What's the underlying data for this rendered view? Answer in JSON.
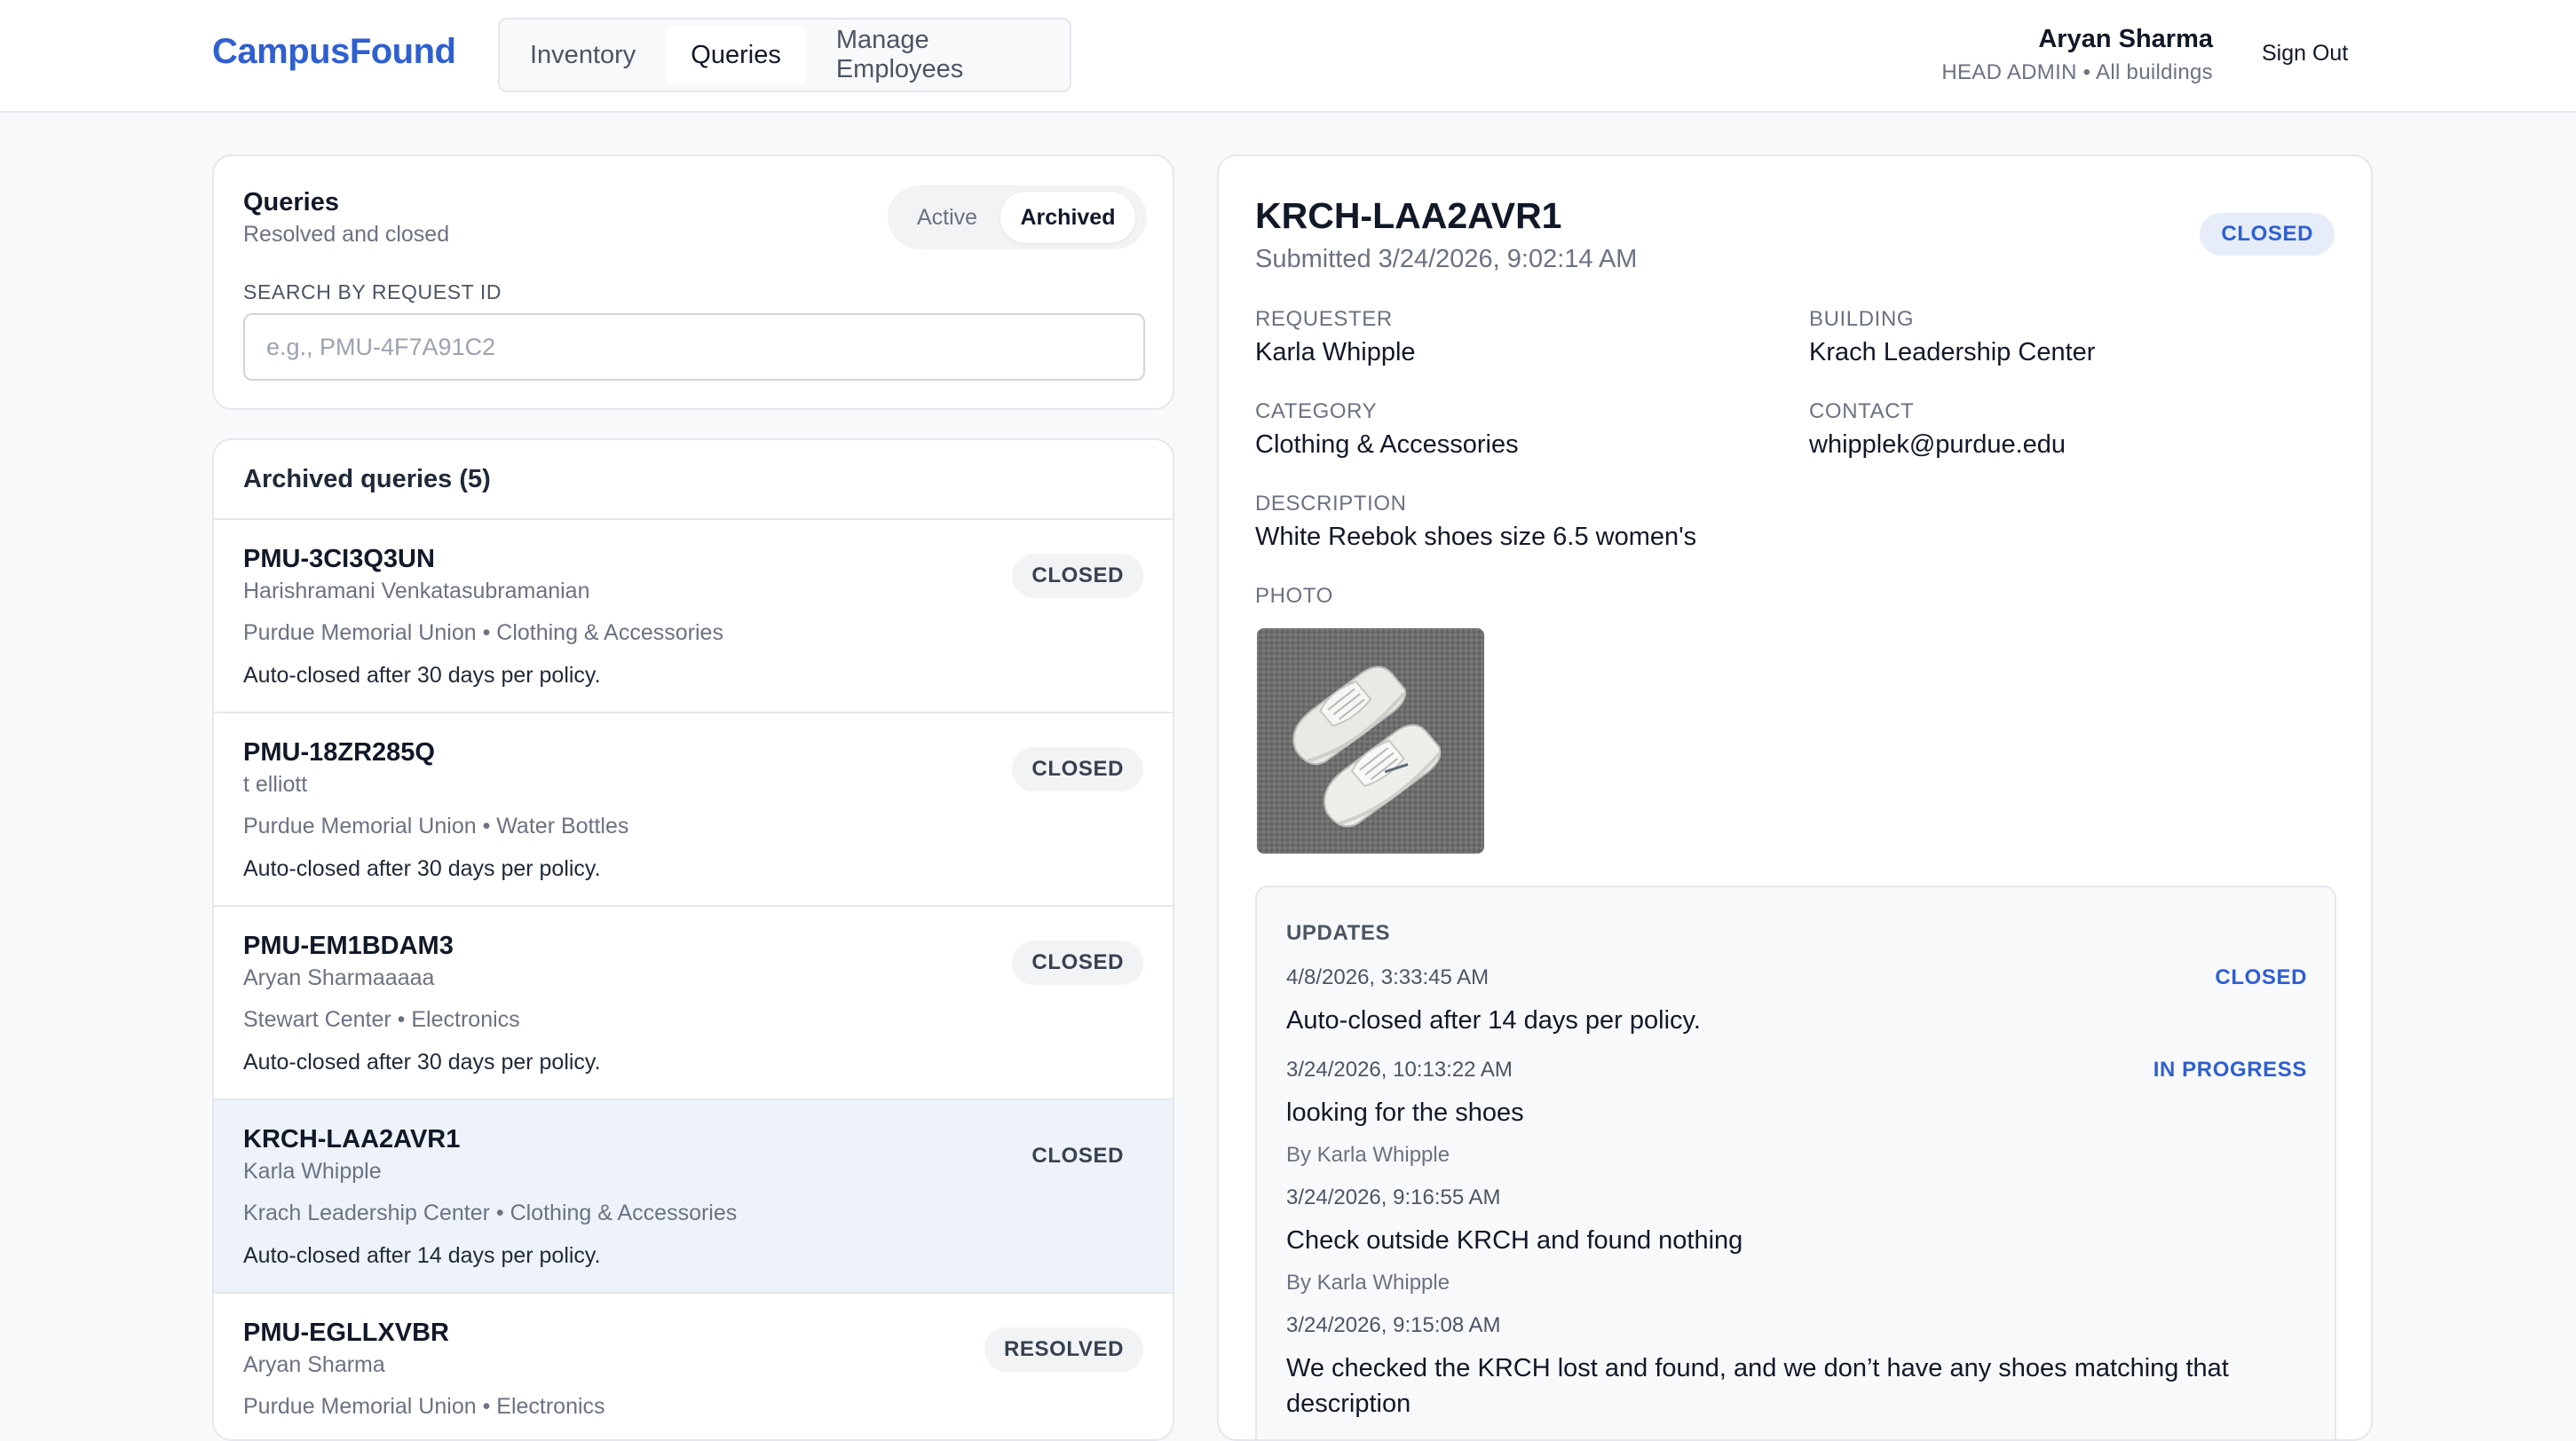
{
  "header": {
    "brand": "CampusFound",
    "tabs": [
      {
        "label": "Inventory",
        "active": false
      },
      {
        "label": "Queries",
        "active": true
      },
      {
        "label": "Manage Employees",
        "active": false
      }
    ],
    "user_name": "Aryan Sharma",
    "user_role": "HEAD ADMIN • All buildings",
    "sign_out": "Sign Out"
  },
  "queries_panel": {
    "title": "Queries",
    "subtitle": "Resolved and closed",
    "toggle": {
      "active_label": "Active",
      "archived_label": "Archived",
      "selected": "Archived"
    },
    "search_label": "SEARCH BY REQUEST ID",
    "search_placeholder": "e.g., PMU-4F7A91C2",
    "search_value": ""
  },
  "archived_list": {
    "header": "Archived queries (5)",
    "items": [
      {
        "id": "PMU-3CI3Q3UN",
        "name": "Harishramani Venkatasubramanian",
        "meta": "Purdue Memorial Union • Clothing & Accessories",
        "note": "Auto-closed after 30 days per policy.",
        "status": "CLOSED",
        "selected": false
      },
      {
        "id": "PMU-18ZR285Q",
        "name": "t elliott",
        "meta": "Purdue Memorial Union • Water Bottles",
        "note": "Auto-closed after 30 days per policy.",
        "status": "CLOSED",
        "selected": false
      },
      {
        "id": "PMU-EM1BDAM3",
        "name": "Aryan Sharmaaaaa",
        "meta": "Stewart Center • Electronics",
        "note": "Auto-closed after 30 days per policy.",
        "status": "CLOSED",
        "selected": false
      },
      {
        "id": "KRCH-LAA2AVR1",
        "name": "Karla Whipple",
        "meta": "Krach Leadership Center • Clothing & Accessories",
        "note": "Auto-closed after 14 days per policy.",
        "status": "CLOSED",
        "selected": true
      },
      {
        "id": "PMU-EGLLXVBR",
        "name": "Aryan Sharma",
        "meta": "Purdue Memorial Union • Electronics",
        "note": "",
        "status": "RESOLVED",
        "selected": false
      }
    ]
  },
  "detail": {
    "id": "KRCH-LAA2AVR1",
    "submitted": "Submitted 3/24/2026, 9:02:14 AM",
    "status": "CLOSED",
    "requester_label": "REQUESTER",
    "requester": "Karla Whipple",
    "building_label": "BUILDING",
    "building": "Krach Leadership Center",
    "category_label": "CATEGORY",
    "category": "Clothing & Accessories",
    "contact_label": "CONTACT",
    "contact": "whipplek@purdue.edu",
    "description_label": "DESCRIPTION",
    "description": "White Reebok shoes size 6.5 women's",
    "photo_label": "PHOTO",
    "updates_title": "UPDATES",
    "updates": [
      {
        "timestamp": "4/8/2026, 3:33:45 AM",
        "text": "Auto-closed after 14 days per policy.",
        "by": "",
        "status": "CLOSED"
      },
      {
        "timestamp": "3/24/2026, 10:13:22 AM",
        "text": "looking for the shoes",
        "by": "By Karla Whipple",
        "status": "IN PROGRESS"
      },
      {
        "timestamp": "3/24/2026, 9:16:55 AM",
        "text": "Check outside KRCH and found nothing",
        "by": "By Karla Whipple",
        "status": ""
      },
      {
        "timestamp": "3/24/2026, 9:15:08 AM",
        "text": "We checked the KRCH lost and found, and we don’t have any shoes matching that description",
        "by": "",
        "status": ""
      }
    ]
  },
  "colors": {
    "brand": "#2f5fd0",
    "selected_row": "#eef3fb",
    "badge_bg": "#f1f3f5"
  }
}
